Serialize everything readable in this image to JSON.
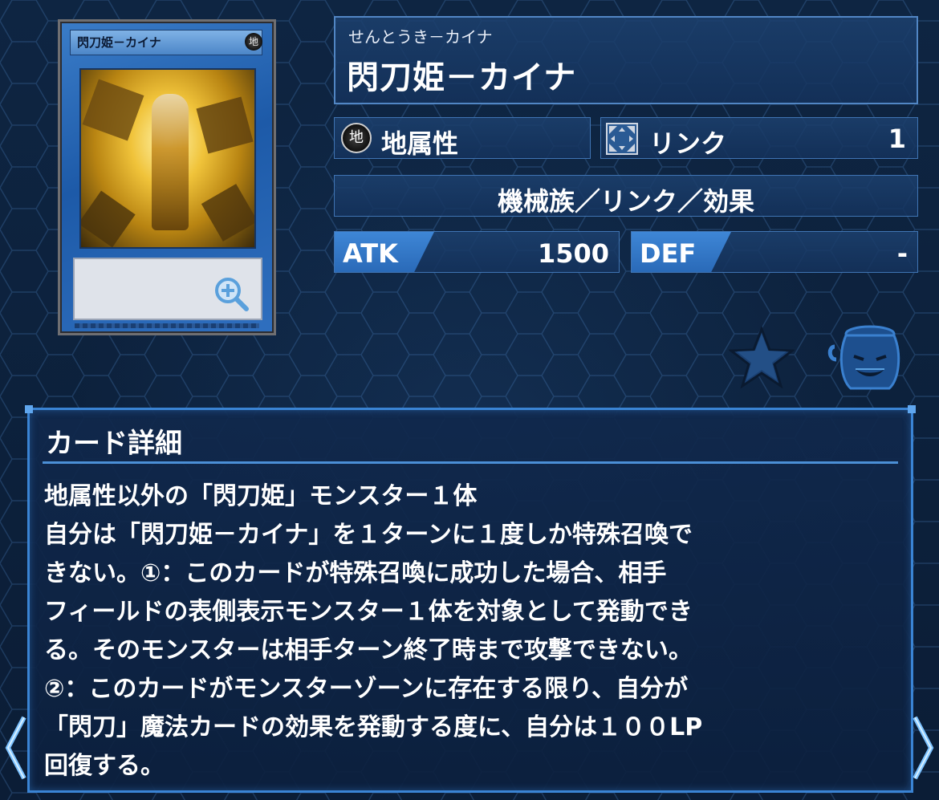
{
  "card": {
    "reading": "せんとうき－カイナ",
    "name": "閃刀姫－カイナ",
    "thumb_name": "閃刀姫－カイナ",
    "thumb_attr": "地"
  },
  "attribute": {
    "icon_glyph": "地",
    "label": "地属性"
  },
  "link": {
    "label": "リンク",
    "value": "1"
  },
  "type_line": "機械族／リンク／効果",
  "stats": {
    "atk_label": "ATK",
    "atk_value": "1500",
    "def_label": "DEF",
    "def_value": "-"
  },
  "detail": {
    "title": "カード詳細",
    "lines": [
      "地属性以外の「閃刀姫」モンスター１体",
      "自分は「閃刀姫－カイナ」を１ターンに１度しか特殊召喚で",
      "きない。①：このカードが特殊召喚に成功した場合、相手",
      "フィールドの表側表示モンスター１体を対象として発動でき",
      "る。そのモンスターは相手ターン終了時まで攻撃できない。",
      "②：このカードがモンスターゾーンに存在する限り、自分が",
      "「閃刀」魔法カードの効果を発動する度に、自分は１００LP",
      "回復する。"
    ]
  },
  "icons": {
    "favorite": "star-icon",
    "pot": "pot-of-greed-icon",
    "zoom": "zoom-in-icon",
    "prev": "chevron-left-icon",
    "next": "chevron-right-icon"
  },
  "colors": {
    "accent": "#3a84d4",
    "panel": "#1c406e",
    "background": "#0d223f"
  }
}
